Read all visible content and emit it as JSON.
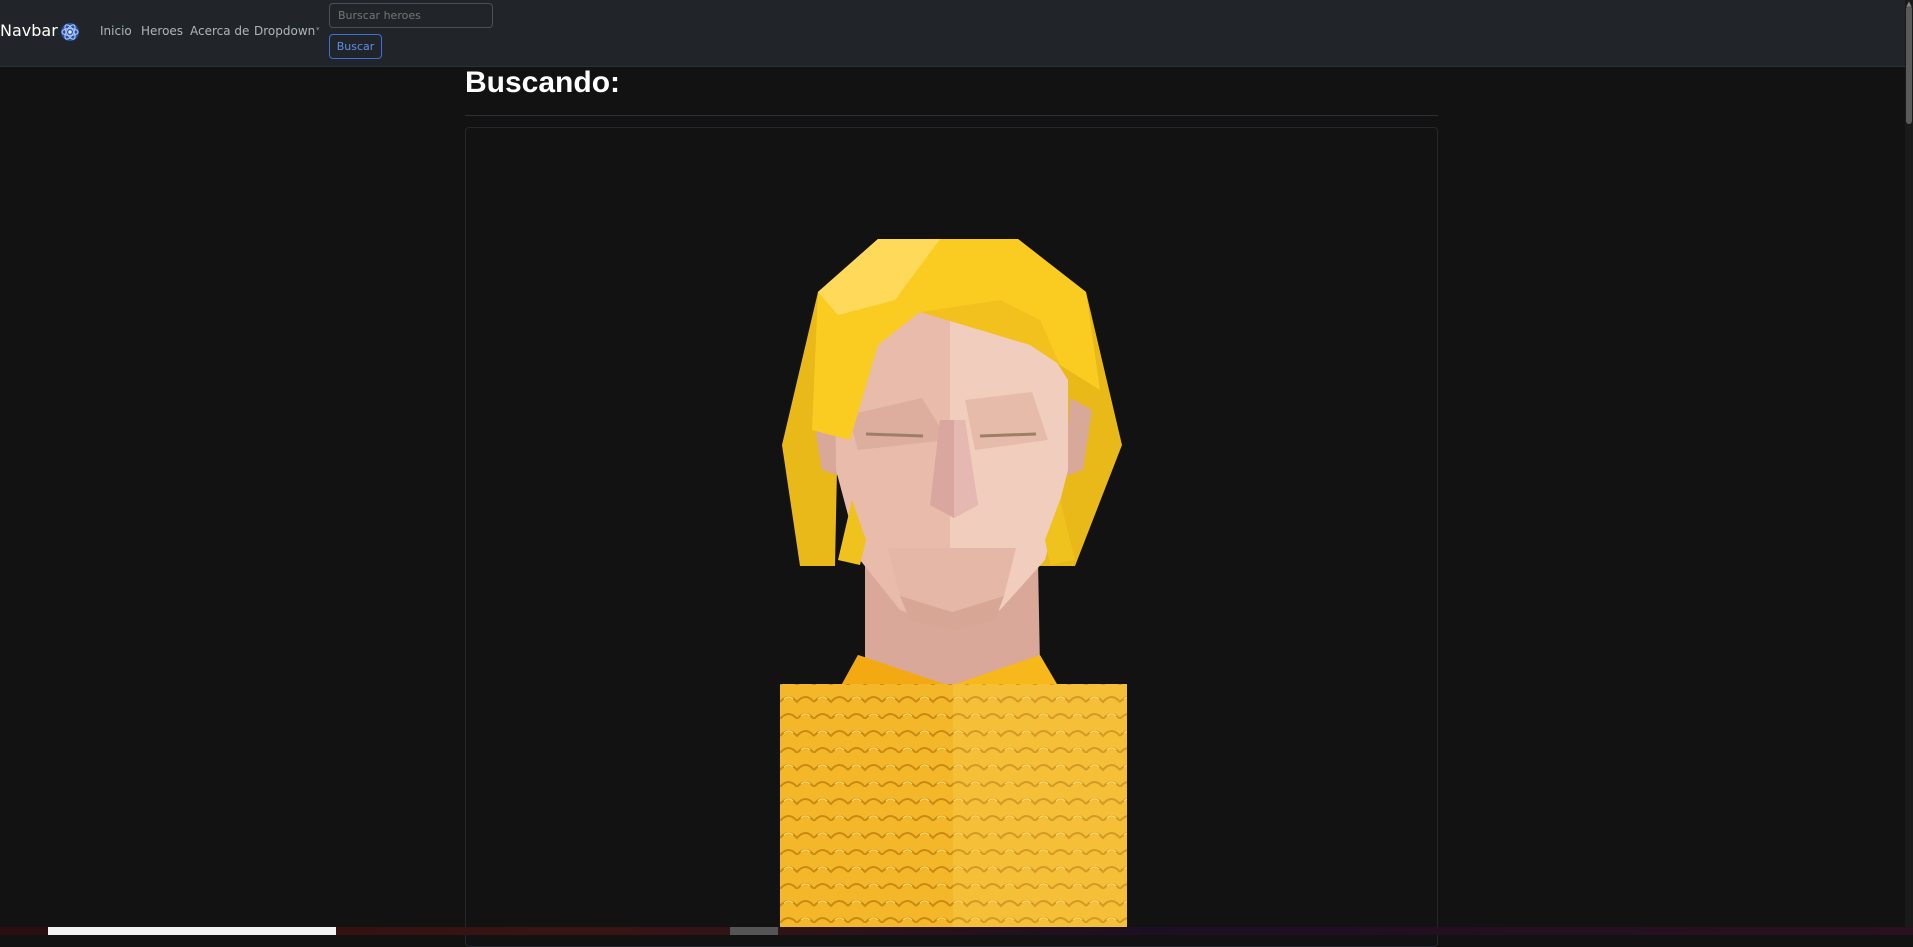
{
  "navbar": {
    "brand": "Navbar",
    "logo_icon": "angular-atom-icon",
    "links": [
      "Inicio",
      "Heroes",
      "Acerca de",
      "Dropdown"
    ],
    "search_placeholder": "Burscar heroes",
    "search_button": "Buscar"
  },
  "main": {
    "title": "Buscando:",
    "image_subject": "hero-portrait-blond-golden-scale-armor"
  },
  "colors": {
    "background": "#121212",
    "navbar": "#212529",
    "primary": "#3d6fd8",
    "hair": "#FACC22",
    "armor": "#F5B72A"
  }
}
